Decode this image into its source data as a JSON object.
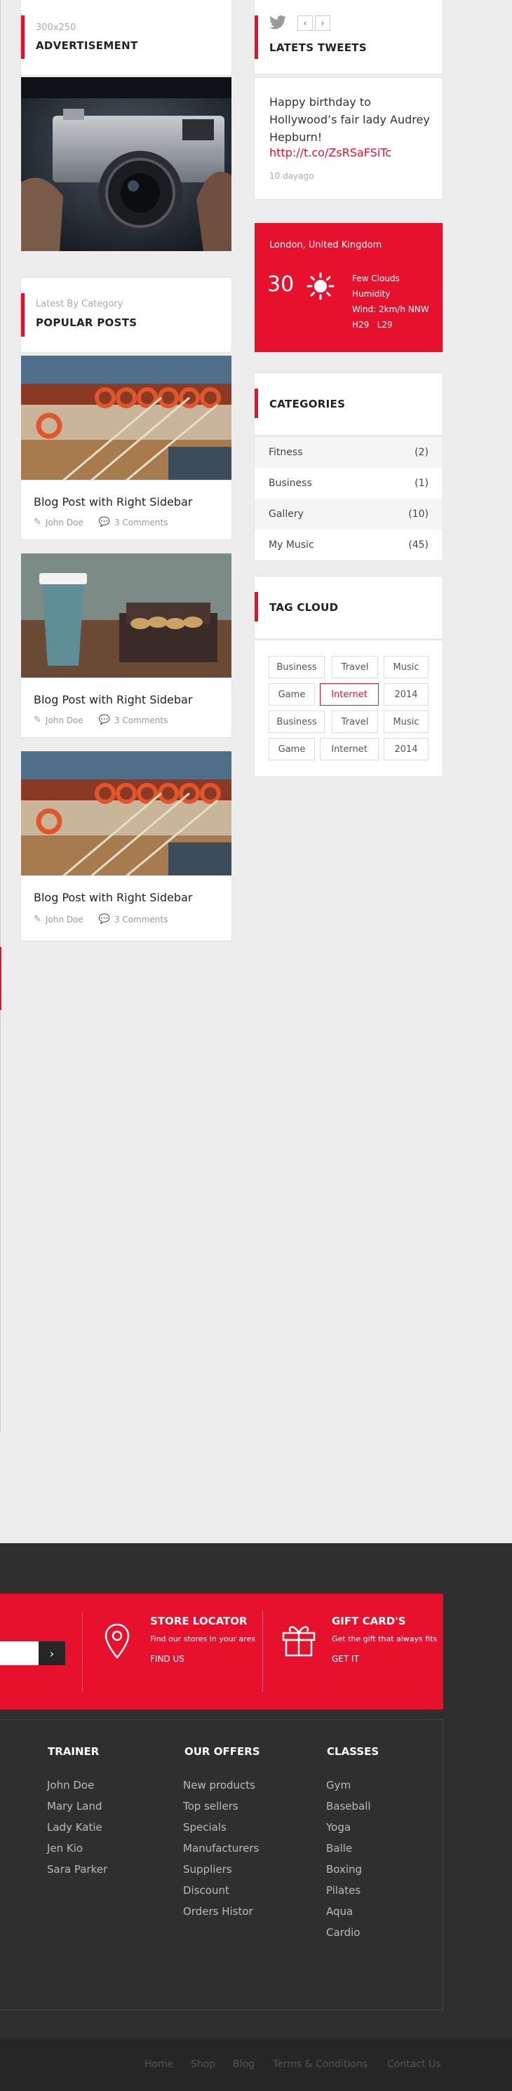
{
  "advertisement": {
    "size": "300x250",
    "title": "ADVERTISEMENT"
  },
  "popular": {
    "subtitle": "Latest By Category",
    "title": "POPULAR POSTS",
    "posts": [
      {
        "title": "Blog Post with Right Sidebar",
        "author": "John Doe",
        "comments": "3 Comments"
      },
      {
        "title": "Blog Post with Right Sidebar",
        "author": "John Doe",
        "comments": "3 Comments"
      },
      {
        "title": "Blog Post with Right Sidebar",
        "author": "John Doe",
        "comments": "3 Comments"
      }
    ]
  },
  "tweets": {
    "title": "LATETS TWEETS",
    "text": "Happy birthday to Hollywood’s fair lady Audrey Hepburn!",
    "link": "http://t.co/ZsRSaFSiTc",
    "time": "10 dayago",
    "prev": "‹",
    "next": "›"
  },
  "weather": {
    "location": "London, United Kingdom",
    "temp": "30",
    "line1": "Few Clouds",
    "line2": "Humidity",
    "line3": "Wind: 2km/h NNW",
    "line4": "H29   L29"
  },
  "categories": {
    "title": "CATEGORIES",
    "items": [
      {
        "name": "Fitness",
        "count": "(2)"
      },
      {
        "name": "Business",
        "count": "(1)"
      },
      {
        "name": "Gallery",
        "count": "(10)"
      },
      {
        "name": "My Music",
        "count": "(45)"
      }
    ]
  },
  "tags": {
    "title": "TAG CLOUD",
    "items": [
      "Business",
      "Travel",
      "Music",
      "Game",
      "Internet",
      "2014",
      "Business",
      "Travel",
      "Music",
      "Game",
      "Internet",
      "2014"
    ]
  },
  "footer": {
    "store": {
      "title": "STORE LOCATOR",
      "text": "Find our stores in your ares",
      "link": "FIND US"
    },
    "gift": {
      "title": "GIFT CARD'S",
      "text": "Get the gift that always fits",
      "link": "GET IT"
    },
    "trainer": {
      "title": "TRAINER",
      "items": [
        "John Doe",
        "Mary Land",
        "Lady Katie",
        "Jen Kio",
        "Sara Parker"
      ]
    },
    "offers": {
      "title": "OUR OFFERS",
      "items": [
        "New products",
        "Top sellers",
        "Specials",
        "Manufacturers",
        "Suppliers",
        "Discount",
        "Orders Histor"
      ]
    },
    "classes": {
      "title": "CLASSES",
      "items": [
        "Gym",
        "Baseball",
        "Yoga",
        "Balle",
        "Boxing",
        "Pilates",
        "Aqua",
        "Cardio"
      ]
    },
    "bottom_links": [
      "Home",
      "Shop",
      "Blog",
      "Terms & Conditions",
      "Contact Us"
    ]
  },
  "colors": {
    "accent": "#e8112d",
    "footer_bg": "#2f2f2f"
  }
}
